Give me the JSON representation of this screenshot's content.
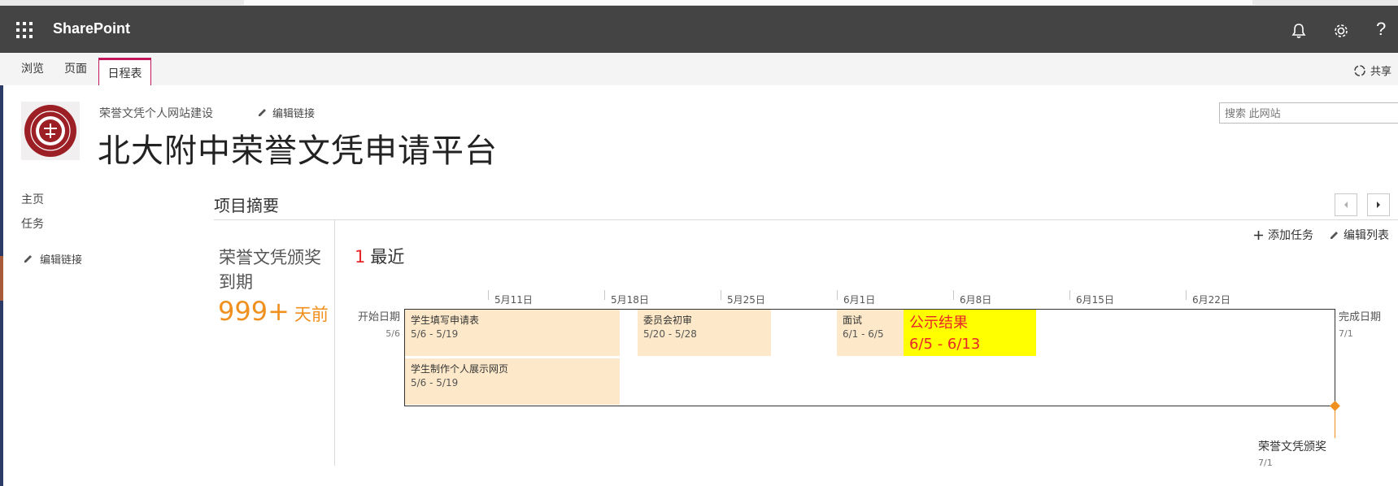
{
  "suite_bar": {
    "app_name": "SharePoint",
    "icons": [
      "app-launcher-icon",
      "bell-icon",
      "gear-icon",
      "help-icon"
    ],
    "help_glyph": "?",
    "background": "#444444"
  },
  "ribbon": {
    "tabs": [
      {
        "label": "浏览",
        "active": false
      },
      {
        "label": "页面",
        "active": false
      },
      {
        "label": "日程表",
        "active": true
      }
    ],
    "share_label": "共享",
    "accent": "#c2185b"
  },
  "site": {
    "parent_link": "荣誉文凭个人网站建设",
    "edit_links": "编辑链接",
    "title": "北大附中荣誉文凭申请平台",
    "search_placeholder": "搜索 此网站"
  },
  "left_nav": {
    "items": [
      "主页",
      "任务"
    ],
    "edit_links": "编辑链接"
  },
  "project_summary": {
    "heading": "项目摘要",
    "due": {
      "label": "荣誉文凭颁奖到期",
      "count": "999+",
      "unit": "天前",
      "color": "#f0901e"
    },
    "recent": {
      "count": "1",
      "label": "最近"
    },
    "commands": {
      "add_task": "添加任务",
      "edit_list": "编辑列表"
    }
  },
  "timeline": {
    "start": {
      "label": "开始日期",
      "date": "5/6"
    },
    "finish": {
      "label": "完成日期",
      "date": "7/1"
    },
    "date_labels": [
      "5月11日",
      "5月18日",
      "5月25日",
      "6月1日",
      "6月8日",
      "6月15日",
      "6月22日"
    ],
    "tasks": [
      {
        "name": "学生填写申请表",
        "dates": "5/6 - 5/19"
      },
      {
        "name": "学生制作个人展示网页",
        "dates": "5/6 - 5/19"
      },
      {
        "name": "委员会初审",
        "dates": "5/20 - 5/28"
      },
      {
        "name": "面试",
        "dates": "6/1 - 6/5"
      },
      {
        "name": "公示结果",
        "dates": "6/5 - 6/13",
        "highlight": "#ffff00"
      }
    ],
    "milestone": {
      "name": "荣誉文凭颁奖",
      "date": "7/1"
    },
    "task_color": "#fde9c9"
  }
}
